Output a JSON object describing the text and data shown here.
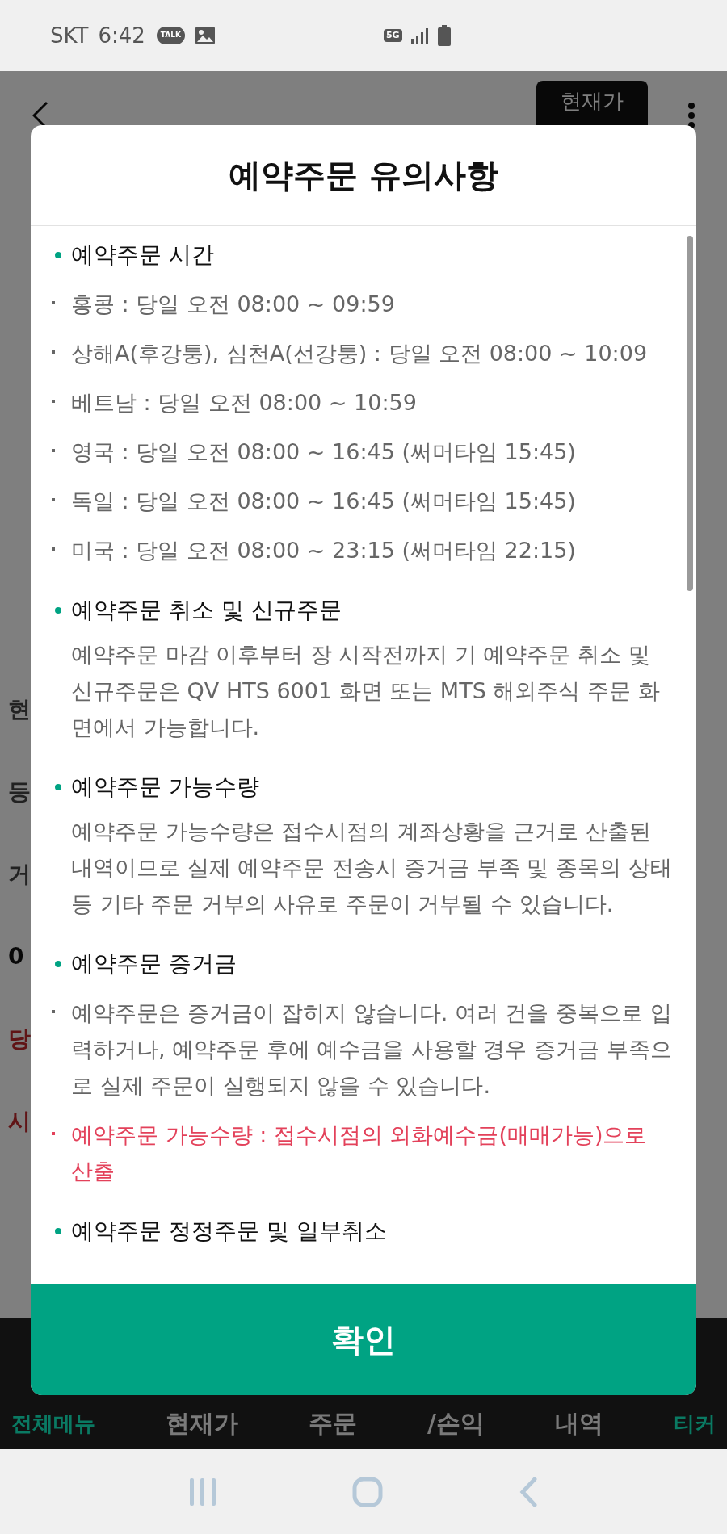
{
  "status_bar": {
    "carrier": "SKT",
    "time": "6:42",
    "talk_badge": "TALK",
    "network": "5G"
  },
  "app_header": {
    "current_price_button": "현재가"
  },
  "background_fragments": [
    {
      "text": "현",
      "kind": "label"
    },
    {
      "text": "등",
      "kind": "label"
    },
    {
      "text": "거",
      "kind": "label"
    },
    {
      "text": "0",
      "kind": "value"
    },
    {
      "text": "당",
      "kind": "alert"
    },
    {
      "text": "시",
      "kind": "alert"
    }
  ],
  "dialog": {
    "title": "예약주문 유의사항",
    "sections": [
      {
        "heading": "예약주문 시간",
        "body": [
          {
            "kind": "item",
            "text": "홍콩 : 당일 오전 08:00 ~ 09:59"
          },
          {
            "kind": "item",
            "text": "상해A(후강퉁), 심천A(선강퉁) : 당일 오전 08:00 ~ 10:09"
          },
          {
            "kind": "item",
            "text": "베트남 : 당일 오전 08:00 ~ 10:59"
          },
          {
            "kind": "item",
            "text": "영국 : 당일 오전 08:00 ~ 16:45 (써머타임 15:45)"
          },
          {
            "kind": "item",
            "text": "독일 : 당일 오전 08:00 ~ 16:45 (써머타임 15:45)"
          },
          {
            "kind": "item",
            "text": "미국 : 당일 오전 08:00 ~ 23:15 (써머타임 22:15)"
          }
        ]
      },
      {
        "heading": "예약주문 취소 및 신규주문",
        "body": [
          {
            "kind": "paragraph",
            "text": "예약주문 마감 이후부터 장 시작전까지 기 예약주문 취소 및 신규주문은 QV HTS 6001 화면 또는 MTS 해외주식 주문 화면에서 가능합니다."
          }
        ]
      },
      {
        "heading": "예약주문 가능수량",
        "body": [
          {
            "kind": "paragraph",
            "text": "예약주문 가능수량은 접수시점의 계좌상황을 근거로 산출된 내역이므로 실제 예약주문 전송시 증거금 부족 및 종목의 상태 등 기타 주문 거부의 사유로 주문이 거부될 수 있습니다."
          }
        ]
      },
      {
        "heading": "예약주문 증거금",
        "body": [
          {
            "kind": "item",
            "text": "예약주문은 증거금이 잡히지 않습니다. 여러 건을 중복으로 입력하거나, 예약주문 후에 예수금을 사용할 경우 증거금 부족으로 실제 주문이 실행되지 않을 수 있습니다."
          },
          {
            "kind": "alert",
            "text": "예약주문 가능수량 : 접수시점의 외화예수금(매매가능)으로 산출"
          }
        ]
      },
      {
        "heading": "예약주문 정정주문 및 일부취소"
      }
    ],
    "confirm_button": "확인"
  },
  "bottom_nav": [
    {
      "label": "전체메뉴",
      "kind": "accent"
    },
    {
      "label": "현재가",
      "kind": "tab"
    },
    {
      "label": "주문",
      "kind": "tab"
    },
    {
      "label": "/손익",
      "kind": "tab"
    },
    {
      "label": "내역",
      "kind": "tab"
    },
    {
      "label": "티커",
      "kind": "accent"
    }
  ]
}
